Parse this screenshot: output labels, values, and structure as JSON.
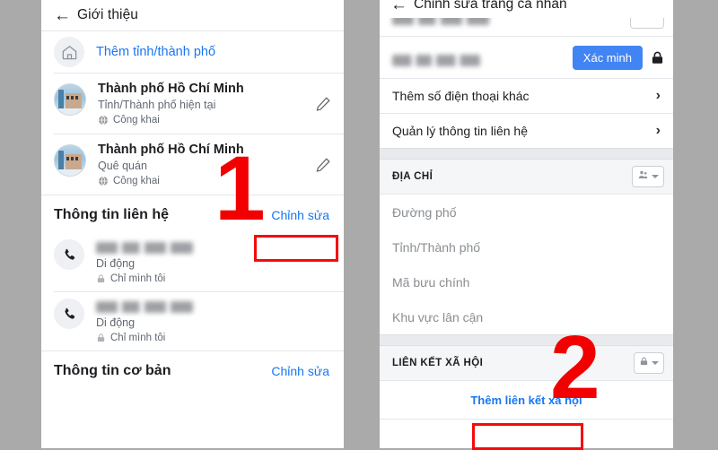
{
  "left": {
    "appbar": {
      "back_icon": "arrow-left-icon",
      "title": "Giới thiệu"
    },
    "add_city": {
      "icon": "home-icon",
      "label": "Thêm tỉnh/thành phố"
    },
    "cities": [
      {
        "title": "Thành phố Hồ Chí Minh",
        "subtitle": "Tỉnh/Thành phố hiện tại",
        "privacy": "Công khai",
        "privacy_icon": "globe-icon",
        "edit_icon": "pencil-icon"
      },
      {
        "title": "Thành phố Hồ Chí Minh",
        "subtitle": "Quê quán",
        "privacy": "Công khai",
        "privacy_icon": "globe-icon",
        "edit_icon": "pencil-icon"
      }
    ],
    "contact_section": {
      "heading": "Thông tin liên hệ",
      "edit_label": "Chỉnh sửa"
    },
    "phones": [
      {
        "icon": "phone-icon",
        "number": "",
        "type": "Di động",
        "privacy": "Chỉ mình tôi",
        "privacy_icon": "lock-icon"
      },
      {
        "icon": "phone-icon",
        "number": "",
        "type": "Di động",
        "privacy": "Chỉ mình tôi",
        "privacy_icon": "lock-icon"
      }
    ],
    "basic_section": {
      "heading": "Thông tin cơ bản",
      "edit_label": "Chỉnh sửa"
    }
  },
  "right": {
    "appbar": {
      "back_icon": "arrow-left-icon",
      "title": "Chỉnh sửa trang cá nhân"
    },
    "phone_entry": {
      "verify_label": "Xác minh",
      "lock_icon": "lock-icon"
    },
    "nav_rows": [
      {
        "label": "Thêm số điện thoại khác",
        "chevron": "chevron-right-icon"
      },
      {
        "label": "Quản lý thông tin liên hệ",
        "chevron": "chevron-right-icon"
      }
    ],
    "address_group": {
      "heading": "ĐỊA CHỈ",
      "audience_icon": "friends-icon",
      "caret_icon": "caret-down-icon",
      "fields": [
        "Đường phố",
        "Tỉnh/Thành phố",
        "Mã bưu chính",
        "Khu vực lân cận"
      ]
    },
    "social_group": {
      "heading": "LIÊN KẾT XÃ HỘI",
      "audience_icon": "lock-icon",
      "caret_icon": "caret-down-icon",
      "add_label": "Thêm liên kết xã hội"
    }
  },
  "annotations": {
    "step1": "1",
    "step2": "2",
    "highlight_color": "#f60a0a"
  }
}
